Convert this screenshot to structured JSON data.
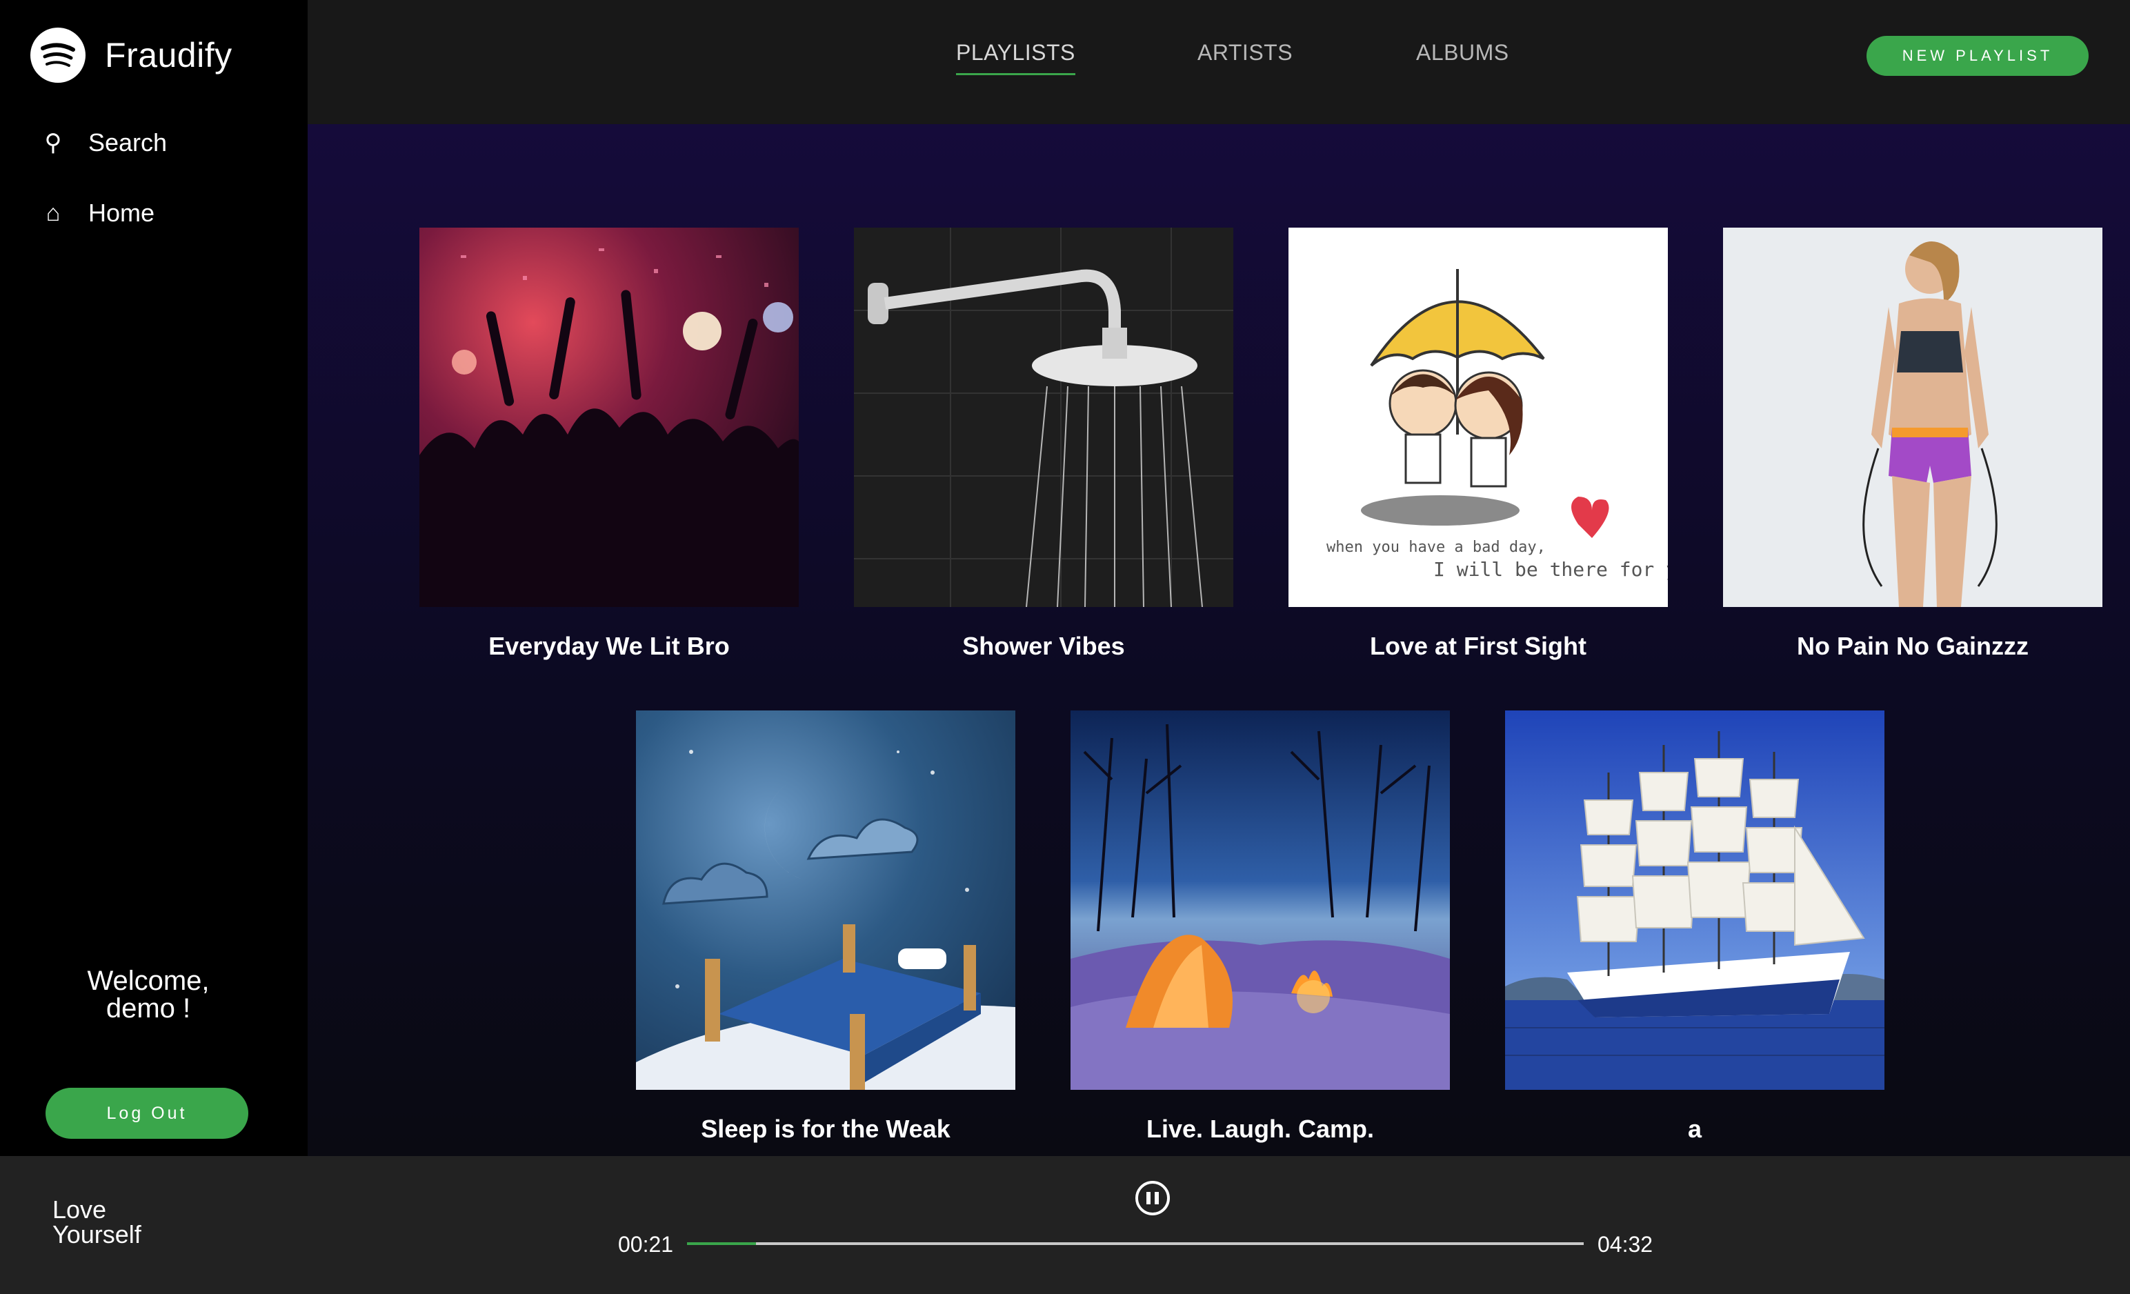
{
  "app": {
    "name": "Fraudify",
    "brand_color": "#3aa64b"
  },
  "sidebar": {
    "items": [
      {
        "label": "Search",
        "icon": "search-icon"
      },
      {
        "label": "Home",
        "icon": "home-icon"
      }
    ],
    "welcome_line1": "Welcome,",
    "welcome_line2": "demo !",
    "logout_label": "Log Out"
  },
  "topbar": {
    "tabs": [
      {
        "label": "PLAYLISTS",
        "active": true
      },
      {
        "label": "ARTISTS",
        "active": false
      },
      {
        "label": "ALBUMS",
        "active": false
      }
    ],
    "new_playlist_label": "NEW PLAYLIST"
  },
  "playlists": [
    {
      "title": "Everyday We Lit Bro",
      "art": "party-crowd"
    },
    {
      "title": "Shower Vibes",
      "art": "shower-head"
    },
    {
      "title": "Love at First Sight",
      "art": "umbrella-couple",
      "art_caption_line1": "when you have a bad day,",
      "art_caption_line2": "I will be there for you."
    },
    {
      "title": "No Pain No Gainzzz",
      "art": "fitness-woman"
    },
    {
      "title": "Sleep is for the Weak",
      "art": "moon-bed"
    },
    {
      "title": "Live. Laugh. Camp.",
      "art": "snow-camp-tent"
    },
    {
      "title": "a",
      "art": "sailing-ship"
    }
  ],
  "player": {
    "track_title": "Love Yourself",
    "current_time": "00:21",
    "total_time": "04:32",
    "progress": 0.077,
    "state": "playing"
  }
}
